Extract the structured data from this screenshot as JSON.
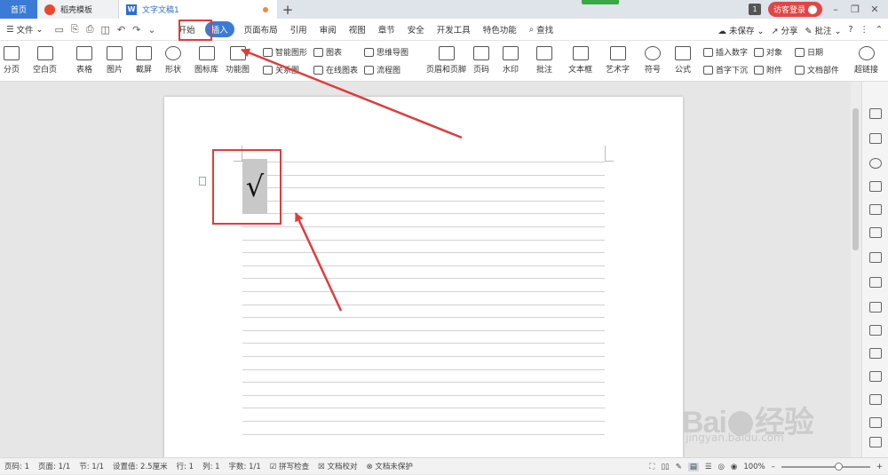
{
  "titlebar": {
    "tabs": [
      {
        "label": "首页"
      },
      {
        "label": "稻壳模板"
      },
      {
        "label": "文字文稿1"
      }
    ],
    "new_tab": "+",
    "badge": "1",
    "login": "访客登录",
    "win_min": "–",
    "win_restore": "❐",
    "win_close": "✕"
  },
  "menubar": {
    "file": "文件",
    "items": [
      "开始",
      "插入",
      "页面布局",
      "引用",
      "审阅",
      "视图",
      "章节",
      "开发工具",
      "安全",
      "开发工具",
      "特色功能"
    ],
    "start": "开始",
    "insert": "插入",
    "layout": "页面布局",
    "ref": "引用",
    "review": "审阅",
    "view": "视图",
    "chapter": "章节",
    "security": "安全",
    "devtools": "开发工具",
    "special": "特色功能",
    "search": "查找",
    "unsaved": "未保存",
    "share": "分享",
    "comment": "批注",
    "help": "?"
  },
  "toolbar": {
    "page_break": "分页",
    "blank_page": "空白页",
    "table": "表格",
    "picture": "图片",
    "screenshot": "截屏",
    "shape": "形状",
    "icon_lib": "图标库",
    "func_chart": "功能图",
    "smart_art": "智能图形",
    "relation": "关系图",
    "chart": "图表",
    "online_chart": "在线图表",
    "mind_map": "思维导图",
    "flow_chart": "流程图",
    "header_footer": "页眉和页脚",
    "page_num": "页码",
    "watermark": "水印",
    "comment": "批注",
    "textbox": "文本框",
    "wordart": "艺术字",
    "symbol": "符号",
    "formula": "公式",
    "insert_number": "插入数字",
    "object": "对象",
    "date": "日期",
    "drop_cap": "首字下沉",
    "attachment": "附件",
    "doc_parts": "文档部件",
    "hyperlink": "超链接"
  },
  "document": {
    "content": "√"
  },
  "statusbar": {
    "page": "页码: 1",
    "pages": "页面: 1/1",
    "section": "节: 1/1",
    "setting": "设置值: 2.5厘米",
    "row": "行: 1",
    "col": "列: 1",
    "words": "字数: 1/1",
    "spell": "拼写检查",
    "proof": "文档校对",
    "protect": "文档未保护",
    "zoom": "100%",
    "zoom_minus": "–",
    "zoom_plus": "+"
  },
  "watermark": {
    "brand": "Bai",
    "brand2": "经验",
    "url": "jingyan.baidu.com"
  },
  "colors": {
    "accent": "#3b7bd6",
    "annotation": "#e23b3b",
    "login": "#e24545"
  }
}
